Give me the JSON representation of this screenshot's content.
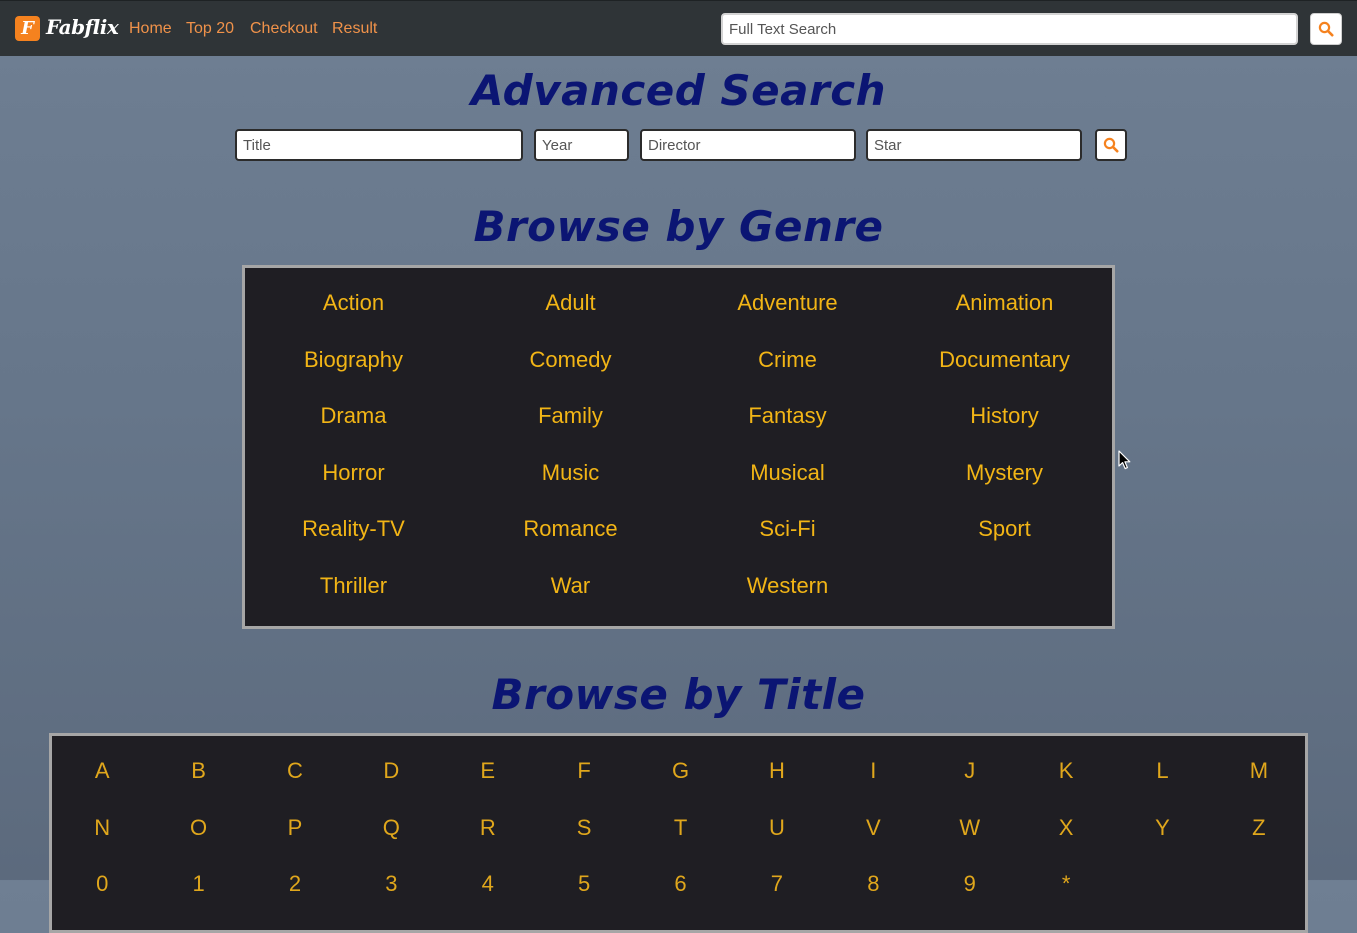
{
  "navbar": {
    "logo_letter": "F",
    "brand": "Fabflix",
    "links": [
      "Home",
      "Top 20",
      "Checkout",
      "Result"
    ],
    "search_placeholder": "Full Text Search"
  },
  "advanced_search": {
    "heading": "Advanced Search",
    "title_placeholder": "Title",
    "year_placeholder": "Year",
    "director_placeholder": "Director",
    "star_placeholder": "Star"
  },
  "genre_section": {
    "heading": "Browse by Genre",
    "genres": [
      "Action",
      "Adult",
      "Adventure",
      "Animation",
      "Biography",
      "Comedy",
      "Crime",
      "Documentary",
      "Drama",
      "Family",
      "Fantasy",
      "History",
      "Horror",
      "Music",
      "Musical",
      "Mystery",
      "Reality-TV",
      "Romance",
      "Sci-Fi",
      "Sport",
      "Thriller",
      "War",
      "Western"
    ]
  },
  "title_section": {
    "heading": "Browse by Title",
    "letters": [
      "A",
      "B",
      "C",
      "D",
      "E",
      "F",
      "G",
      "H",
      "I",
      "J",
      "K",
      "L",
      "M",
      "N",
      "O",
      "P",
      "Q",
      "R",
      "S",
      "T",
      "U",
      "V",
      "W",
      "X",
      "Y",
      "Z",
      "0",
      "1",
      "2",
      "3",
      "4",
      "5",
      "6",
      "7",
      "8",
      "9",
      "*"
    ]
  },
  "colors": {
    "accent": "#f5821f",
    "heading": "#0b1573",
    "genre_link": "#f2b516",
    "panel": "#1f1e23"
  },
  "icons": {
    "search_button": "search-icon",
    "cursor": "mouse-pointer-icon"
  }
}
